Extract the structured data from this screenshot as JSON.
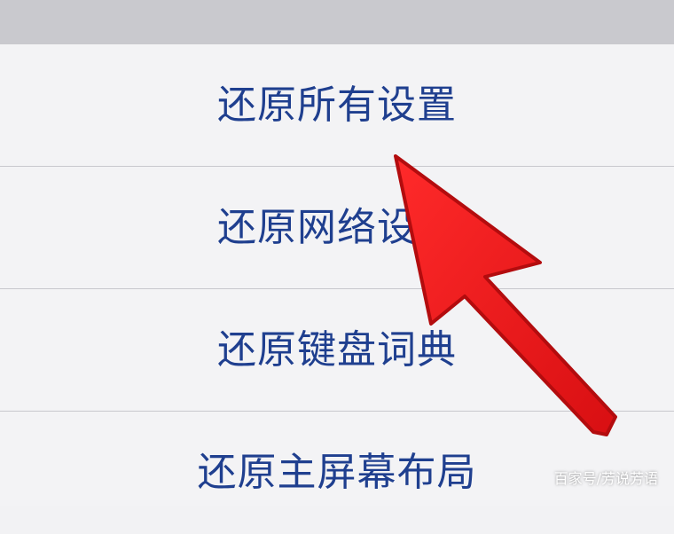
{
  "settings_list": {
    "items": [
      {
        "label": "还原所有设置"
      },
      {
        "label": "还原网络设置"
      },
      {
        "label": "还原键盘词典"
      },
      {
        "label": "还原主屏幕布局"
      }
    ]
  },
  "annotation": {
    "icon": "red-arrow-icon",
    "color": "#e81416"
  },
  "watermark": {
    "text": "百家号/芳说芳语"
  },
  "colors": {
    "label": "#1f3f8f",
    "header_band": "#c9c9ce",
    "row_background": "#f3f3f5",
    "separator": "#c8c8cd"
  }
}
